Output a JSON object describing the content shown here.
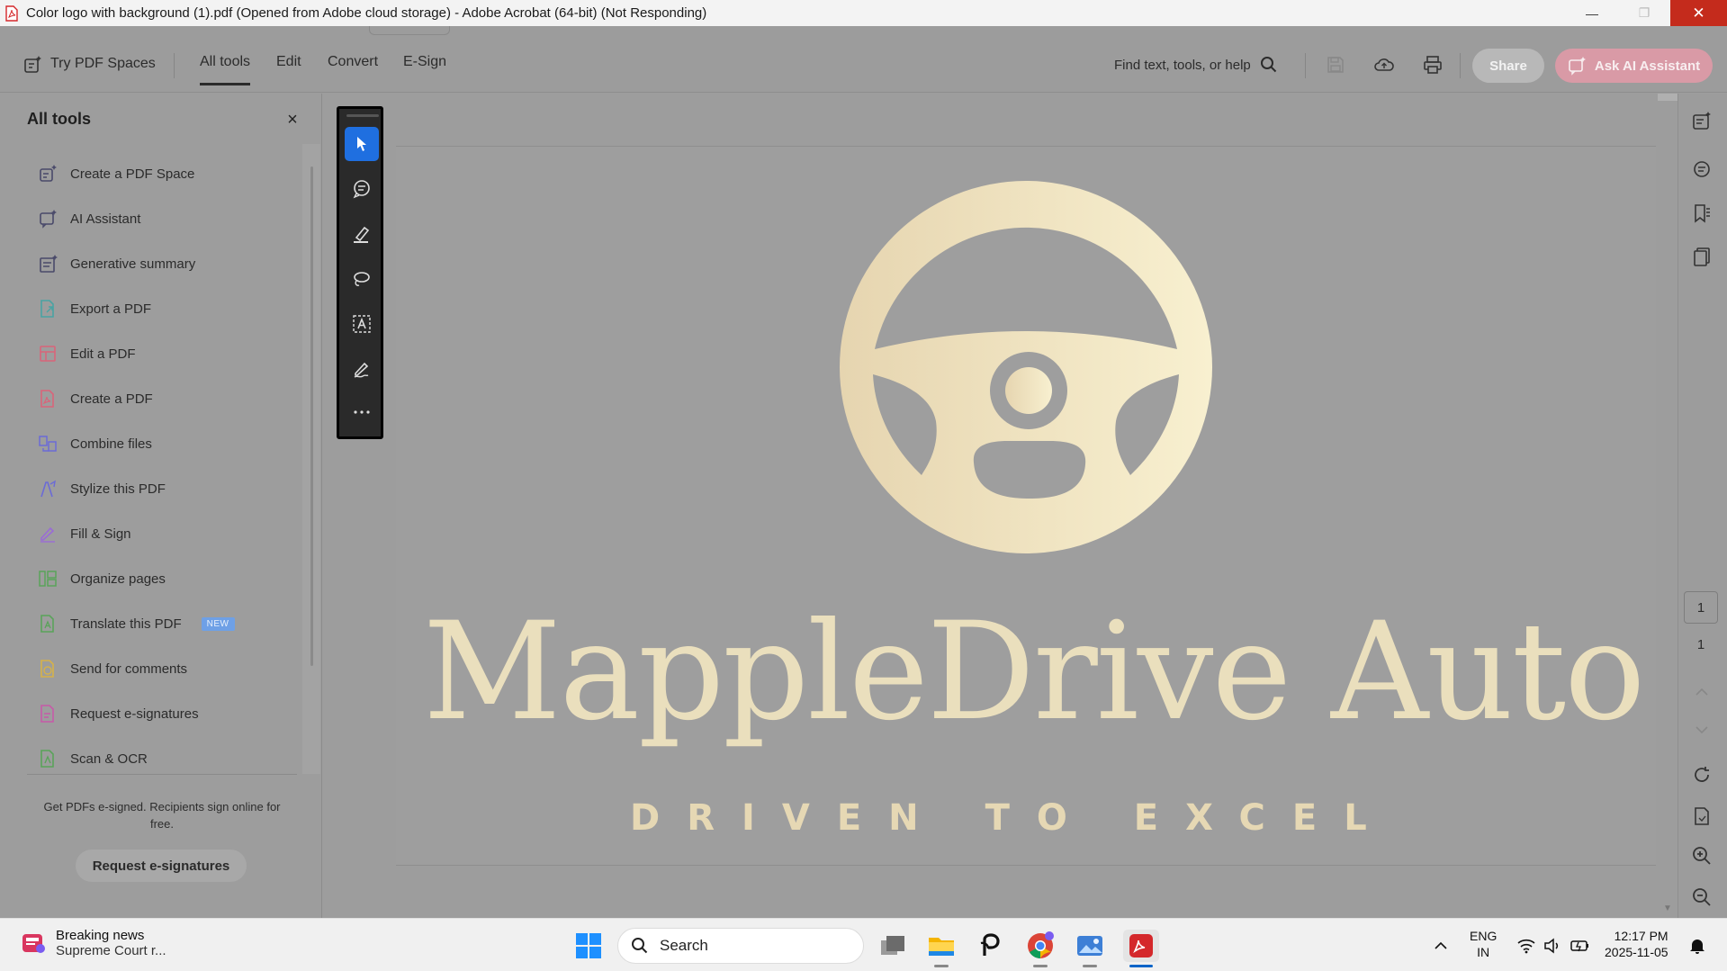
{
  "window": {
    "title": "Color logo with background (1).pdf (Opened from Adobe cloud storage) - Adobe Acrobat (64-bit) (Not Responding)",
    "minimize": "—",
    "maximize": "❐",
    "close": "✕"
  },
  "toolbar": {
    "try_spaces": "Try PDF Spaces",
    "tabs": [
      "All tools",
      "Edit",
      "Convert",
      "E-Sign"
    ],
    "active_tab": "All tools",
    "find_placeholder": "Find text, tools, or help",
    "share": "Share",
    "ask_ai": "Ask AI Assistant"
  },
  "left_panel": {
    "title": "All tools",
    "close": "×",
    "tools": [
      {
        "label": "Create a PDF Space",
        "icon": "pdf-space-icon",
        "color": "#4a4a6a"
      },
      {
        "label": "AI Assistant",
        "icon": "ai-assistant-icon",
        "color": "#4a4a6a"
      },
      {
        "label": "Generative summary",
        "icon": "summary-icon",
        "color": "#4a4a6a"
      },
      {
        "label": "Export a PDF",
        "icon": "export-pdf-icon",
        "color": "#4aa3a3"
      },
      {
        "label": "Edit a PDF",
        "icon": "edit-pdf-icon",
        "color": "#d9647a"
      },
      {
        "label": "Create a PDF",
        "icon": "create-pdf-icon",
        "color": "#d9647a"
      },
      {
        "label": "Combine files",
        "icon": "combine-files-icon",
        "color": "#6b6bd6"
      },
      {
        "label": "Stylize this PDF",
        "icon": "stylize-icon",
        "color": "#6b6bd6"
      },
      {
        "label": "Fill & Sign",
        "icon": "fill-sign-icon",
        "color": "#9a6bd6"
      },
      {
        "label": "Organize pages",
        "icon": "organize-pages-icon",
        "color": "#5aa35a"
      },
      {
        "label": "Translate this PDF",
        "icon": "translate-icon",
        "color": "#5aa35a",
        "badge": "NEW"
      },
      {
        "label": "Send for comments",
        "icon": "send-comments-icon",
        "color": "#d6b24a"
      },
      {
        "label": "Request e-signatures",
        "icon": "request-esign-icon",
        "color": "#c75aa8"
      },
      {
        "label": "Scan & OCR",
        "icon": "scan-ocr-icon",
        "color": "#5aa35a"
      }
    ],
    "promo_text": "Get PDFs e-signed. Recipients sign online for free.",
    "promo_button": "Request e-signatures"
  },
  "vertical_tools": [
    "select-tool-icon",
    "comment-tool-icon",
    "highlight-tool-icon",
    "draw-tool-icon",
    "text-select-tool-icon",
    "sign-tool-icon",
    "more-tools-icon"
  ],
  "document": {
    "brand_name": "MappleDrive Auto",
    "tagline": "DRIVEN TO EXCEL",
    "logo_color": "#efe4c2"
  },
  "page_nav": {
    "current_page": "1",
    "total_pages": "1"
  },
  "taskbar": {
    "news_title": "Breaking news",
    "news_subtitle": "Supreme Court r...",
    "search_placeholder": "Search",
    "lang_line1": "ENG",
    "lang_line2": "IN",
    "time": "12:17 PM",
    "date": "2025-11-05"
  }
}
